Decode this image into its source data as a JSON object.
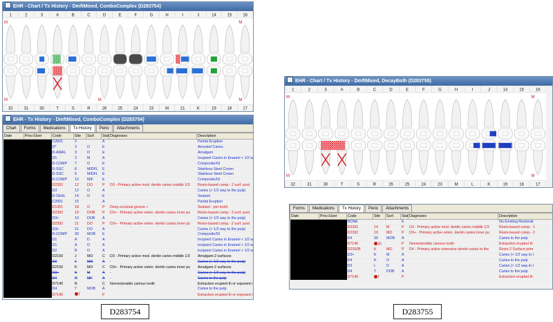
{
  "left": {
    "chart_title": "EHR - Chart / Tx History - DmftMixed, ComboComplex (D283754)",
    "upper_numbers": [
      "1",
      "2",
      "3",
      "A",
      "B",
      "C",
      "D",
      "E",
      "F",
      "G",
      "H",
      "I",
      "J",
      "14",
      "15",
      "16"
    ],
    "lower_numbers": [
      "32",
      "31",
      "30",
      "T",
      "S",
      "R",
      "26",
      "25",
      "24",
      "23",
      "M",
      "21",
      "K",
      "19",
      "18",
      "17"
    ],
    "tx_title": "EHR - Tx History - DmftMixed, ComboComplex (D283754)",
    "tabs": [
      "Chart",
      "Forms",
      "Medications",
      "Tx History",
      "Perio",
      "Attachments"
    ],
    "active_tab": "Tx History",
    "columns": [
      "Date",
      "Prov./User",
      "Code",
      "Site",
      "Surf.",
      "Stat",
      "Diagnoses",
      "Description"
    ],
    "rows": [
      {
        "code": "C2001",
        "site": "2",
        "surf": "",
        "stat": "A",
        "diag": "",
        "desc": "Partial Eruption",
        "color": "blue"
      },
      {
        "code": "D*",
        "site": "3",
        "surf": "O",
        "stat": "E",
        "diag": "",
        "desc": "Arrested Caries",
        "color": "blue"
      },
      {
        "code": "D-AMAL",
        "site": "3",
        "surf": "O",
        "stat": "E",
        "diag": "",
        "desc": "Amalgam",
        "color": "blue"
      },
      {
        "code": "D1",
        "site": "3",
        "surf": "M",
        "stat": "A",
        "diag": "",
        "desc": "Incipient Caries in Enamel < 1/2 wa",
        "color": "blue"
      },
      {
        "code": "D-COMP",
        "site": "7",
        "surf": "O",
        "stat": "E",
        "diag": "",
        "desc": "Composite/GI",
        "color": "blue"
      },
      {
        "code": "D-SSC",
        "site": "8",
        "surf": "MIDFL",
        "stat": "E",
        "diag": "",
        "desc": "Stainless Steel Crown",
        "color": "blue"
      },
      {
        "code": "D-SSC",
        "site": "9",
        "surf": "MIDFL",
        "stat": "E",
        "diag": "",
        "desc": "Stainless Steel Crown",
        "color": "blue"
      },
      {
        "code": "D-COMP",
        "site": "10",
        "surf": "MIF",
        "stat": "E",
        "diag": "",
        "desc": "Composite/GI",
        "color": "blue"
      },
      {
        "code": "D2392",
        "site": "12",
        "surf": "DO",
        "stat": "P",
        "diag": "D3 - Primary active mod. dentin caries middle 1/3",
        "desc": "Resin-based comp.- 2 surf. post",
        "color": "red"
      },
      {
        "code": "D3",
        "site": "12",
        "surf": "O",
        "stat": "A",
        "diag": "",
        "desc": "Caries (> 1/2 way to the pulp)",
        "color": "blue"
      },
      {
        "code": "D-SEAL",
        "site": "14",
        "surf": "O",
        "stat": "E",
        "diag": "",
        "desc": "Sealant",
        "color": "blue"
      },
      {
        "code": "C2001",
        "site": "15",
        "surf": "",
        "stat": "A",
        "diag": "",
        "desc": "Partial Eruption",
        "color": "blue"
      },
      {
        "code": "D1351",
        "site": "18",
        "surf": "O",
        "stat": "P",
        "diag": "Deep occlusal groove +",
        "desc": "Sealant - per tooth",
        "color": "red"
      },
      {
        "code": "D2393",
        "site": "19",
        "surf": "DOB",
        "stat": "P",
        "diag": "D3+ - Primary active exten. dentin caries inner pu",
        "desc": "Resin-based comp.- 3 surf. post",
        "color": "red"
      },
      {
        "code": "D3+",
        "site": "19",
        "surf": "DOB",
        "stat": "A",
        "diag": "",
        "desc": "Caries (> 1/2 way to the pulp)",
        "color": "blue"
      },
      {
        "code": "D2392",
        "site": "21",
        "surf": "DO",
        "stat": "P",
        "diag": "D3+ - Primary active exten. dentin caries inner pu",
        "desc": "Resin-based comp.- 2 surf. post",
        "color": "red"
      },
      {
        "code": "D3+",
        "site": "21",
        "surf": "DO",
        "stat": "A",
        "diag": "",
        "desc": "Caries (> 1/2 way to the pulp)",
        "color": "blue"
      },
      {
        "code": "D-COMP",
        "site": "30",
        "surf": "MOB",
        "stat": "E",
        "diag": "",
        "desc": "Composite/GI",
        "color": "blue"
      },
      {
        "code": "D1",
        "site": "A",
        "surf": "D",
        "stat": "A",
        "diag": "",
        "desc": "Incipient Caries in Enamel < 1/2 wa",
        "color": "blue"
      },
      {
        "code": "D1",
        "site": "A",
        "surf": "O",
        "stat": "A",
        "diag": "",
        "desc": "Incipient Caries in Enamel > 1/2 wa",
        "color": "blue"
      },
      {
        "code": "D2",
        "site": "B",
        "surf": "O",
        "stat": "A",
        "diag": "",
        "desc": "Incipient Caries in Enamel > 1/2 wa",
        "color": "blue"
      },
      {
        "code": "D2150",
        "site": "J",
        "surf": "MO",
        "stat": "C",
        "diag": "D3 - Primary active mod. dentin caries middle 1/3",
        "desc": "Amalgam-2 surfaces",
        "color": "black"
      },
      {
        "code": "D3",
        "site": "J",
        "surf": "MO",
        "stat": "A",
        "diag": "-",
        "desc": "Caries (> 1/2 way to the pulp)",
        "color": "blue",
        "strike": true
      },
      {
        "code": "D2150",
        "site": "K",
        "surf": "MO",
        "stat": "C",
        "diag": "D3+ - Primary active exten. dentin caries inner pu",
        "desc": "Amalgam-2 surfaces",
        "color": "black"
      },
      {
        "code": "D3+",
        "site": "K",
        "surf": "M",
        "stat": "A",
        "diag": "-",
        "desc": "Caries (> 1/2 way to the pulp)",
        "color": "blue",
        "strike": true
      },
      {
        "code": "D4",
        "site": "R",
        "surf": "MF",
        "stat": "A",
        "diag": "-",
        "desc": "Caries to the pulp",
        "color": "blue",
        "strike": true
      },
      {
        "code": "D7140",
        "site": "R",
        "surf": "",
        "stat": "C",
        "diag": "Nonrestorable carious tooth",
        "desc": "Extraction erupted th or exposed ro",
        "color": "black"
      },
      {
        "code": "D4",
        "site": "T",
        "surf": "MOB",
        "stat": "A",
        "diag": "",
        "desc": "Caries to the pulp",
        "color": "blue"
      },
      {
        "code": "D7140",
        "site": "T",
        "surf": "",
        "stat": "P",
        "diag": "",
        "desc": "Extraction erupted th or exposed ro",
        "color": "red",
        "dot": true
      }
    ],
    "caption": "D283754"
  },
  "right": {
    "chart_title": "EHR - Chart / Tx History - DmftMixed, DecayBoth (D283755)",
    "upper_numbers": [
      "1",
      "2",
      "3",
      "A",
      "B",
      "C",
      "D",
      "E",
      "F",
      "G",
      "H",
      "I",
      "J",
      "14",
      "15",
      "16"
    ],
    "lower_numbers": [
      "32",
      "31",
      "30",
      "T",
      "S",
      "R",
      "26",
      "25",
      "24",
      "23",
      "M",
      "L",
      "K",
      "19",
      "18",
      "17"
    ],
    "tabs": [
      "Forms",
      "Medications",
      "Tx History",
      "Perio",
      "Attachments"
    ],
    "active_tab": "Tx History",
    "columns": [
      "Date",
      "Prov./User",
      "Code",
      "Site",
      "Surf.",
      "Stat",
      "Diagnoses",
      "Description"
    ],
    "rows": [
      {
        "code": "NONE",
        "site": "",
        "surf": "",
        "stat": "E",
        "diag": "",
        "desc": "No Existing Restorati",
        "color": "blue"
      },
      {
        "code": "D2391",
        "site": "14",
        "surf": "M",
        "stat": "P",
        "diag": "D3 - Primary active mod. dentin caries middle 1/3",
        "desc": "Resin-based comp.- 1",
        "color": "red"
      },
      {
        "code": "D2392",
        "site": "19",
        "surf": "MO",
        "stat": "P",
        "diag": "D3+ - Primary active exten. dentin caries inner pu",
        "desc": "Resin-based comp.- 2",
        "color": "red"
      },
      {
        "code": "D4",
        "site": "30",
        "surf": "MOB",
        "stat": "A",
        "diag": "",
        "desc": "Caries to the pulp",
        "color": "blue"
      },
      {
        "code": "D7140",
        "site": "30",
        "surf": "",
        "stat": "P",
        "diag": "Nonrestorable carious tooth",
        "desc": "Extraction erupted th",
        "color": "red",
        "dot": true
      },
      {
        "code": "D2392B",
        "site": "K",
        "surf": "MO",
        "stat": "P",
        "diag": "D4 - Primary active extensive dentin caries to the",
        "desc": "Resin 2 Surface prim",
        "color": "red"
      },
      {
        "code": "D3+",
        "site": "K",
        "surf": "M",
        "stat": "A",
        "diag": "",
        "desc": "Caries (> 1/2 way to t",
        "color": "blue"
      },
      {
        "code": "D4",
        "site": "K",
        "surf": "O",
        "stat": "A",
        "diag": "",
        "desc": "Caries to the pulp",
        "color": "blue"
      },
      {
        "code": "D3",
        "site": "L",
        "surf": "D",
        "stat": "A",
        "diag": "",
        "desc": "Caries (> 1/2 way to t",
        "color": "blue"
      },
      {
        "code": "D4",
        "site": "T",
        "surf": "DOB",
        "stat": "A",
        "diag": "",
        "desc": "Caries to the pulp",
        "color": "blue"
      },
      {
        "code": "D7140",
        "site": "T",
        "surf": "",
        "stat": "P",
        "diag": "",
        "desc": "Extraction erupted th",
        "color": "red",
        "dot": true
      }
    ],
    "caption": "D283755"
  }
}
